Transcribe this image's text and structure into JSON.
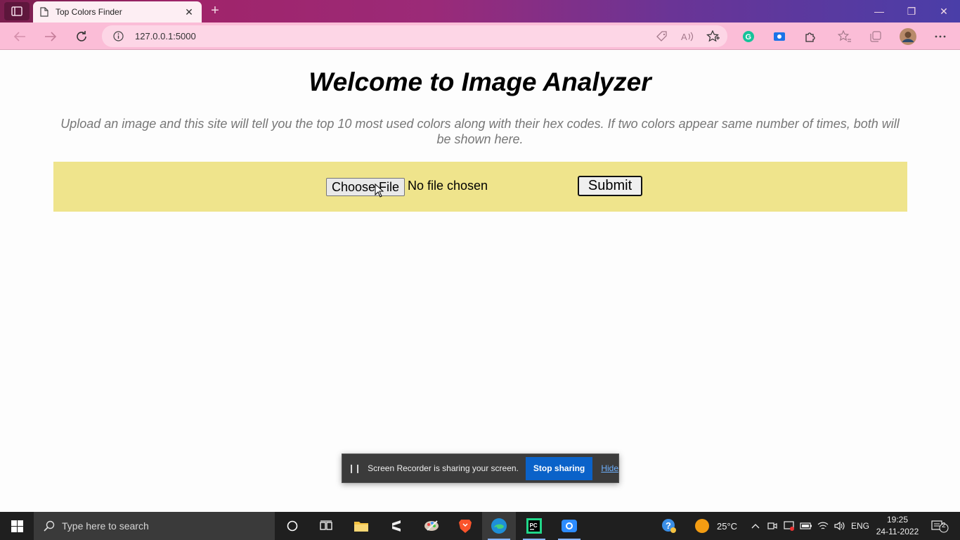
{
  "browser": {
    "tab_title": "Top Colors Finder",
    "url": "127.0.0.1:5000"
  },
  "page": {
    "title": "Welcome to Image Analyzer",
    "description": "Upload an image and this site will tell you the top 10 most used colors along with their hex codes. If two colors appear same number of times, both will be shown here.",
    "choose_file_label": "Choose File",
    "no_file_text": "No file chosen",
    "submit_label": "Submit",
    "band_color": "#efe48c"
  },
  "recorder": {
    "message": "Screen Recorder is sharing your screen.",
    "stop_label": "Stop sharing",
    "hide_label": "Hide"
  },
  "taskbar": {
    "search_placeholder": "Type here to search",
    "weather": "25°C",
    "language": "ENG",
    "time": "19:25",
    "date": "24-11-2022",
    "notification_count": "2",
    "apps": [
      "cortana-icon",
      "task-view-icon",
      "file-explorer-icon",
      "sublime-text-icon",
      "paint-icon",
      "brave-icon",
      "edge-icon",
      "pycharm-icon",
      "zoom-icon"
    ]
  }
}
